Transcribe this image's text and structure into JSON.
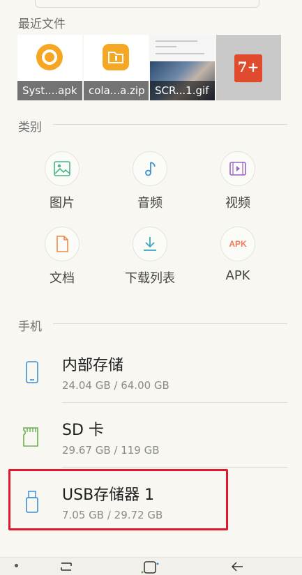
{
  "sections": {
    "recent": "最近文件",
    "category": "类别",
    "phone": "手机"
  },
  "recent_files": [
    {
      "name": "Syst....apk",
      "icon": "android-oreo-icon",
      "color": "#f6a623"
    },
    {
      "name": "cola...a.zip",
      "icon": "zip-folder-icon",
      "color": "#f5a623"
    },
    {
      "name": "SCR...1.gif",
      "icon": "screenshot-thumbnail"
    },
    {
      "name": "",
      "icon": "app-logo-7plus",
      "logo_text": "7+",
      "color": "#e04b2e"
    }
  ],
  "categories": [
    {
      "label": "图片",
      "icon": "image-icon",
      "color": "#48b58a"
    },
    {
      "label": "音频",
      "icon": "music-note-icon",
      "color": "#3d8fd1"
    },
    {
      "label": "视频",
      "icon": "video-icon",
      "color": "#9b5fc6"
    },
    {
      "label": "文档",
      "icon": "document-icon",
      "color": "#f08a4b"
    },
    {
      "label": "下载列表",
      "icon": "download-icon",
      "color": "#3aa9b9"
    },
    {
      "label": "APK",
      "icon": "apk-icon",
      "color": "#ef7a56"
    }
  ],
  "storage": [
    {
      "name": "内部存储",
      "usage": "24.04 GB / 64.00 GB",
      "icon": "phone-icon",
      "color": "#3d8fd1"
    },
    {
      "name": "SD 卡",
      "usage": "29.67 GB / 119 GB",
      "icon": "sd-card-icon",
      "color": "#6ab04c"
    },
    {
      "name": "USB存储器 1",
      "usage": "7.05 GB / 29.72 GB",
      "icon": "usb-drive-icon",
      "color": "#3d8fd1"
    }
  ],
  "colors": {
    "highlight": "#e0182e",
    "background": "#f8f7f2"
  }
}
